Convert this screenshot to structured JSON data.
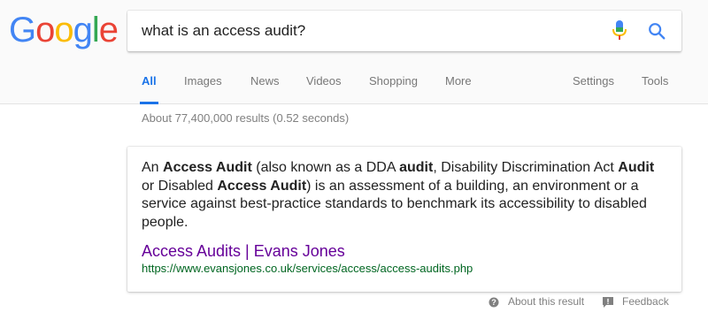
{
  "logo": {
    "letters": [
      "G",
      "o",
      "o",
      "g",
      "l",
      "e"
    ],
    "colors": [
      "#4285F4",
      "#EA4335",
      "#FBBC05",
      "#4285F4",
      "#34A853",
      "#EA4335"
    ]
  },
  "search": {
    "query": "what is an access audit?",
    "mic_icon": "microphone-icon",
    "search_icon": "search-icon"
  },
  "tabs": {
    "items": [
      {
        "label": "All",
        "active": true
      },
      {
        "label": "Images"
      },
      {
        "label": "News"
      },
      {
        "label": "Videos"
      },
      {
        "label": "Shopping"
      },
      {
        "label": "More"
      }
    ],
    "settings_label": "Settings",
    "tools_label": "Tools",
    "accent_color": "#1a73e8"
  },
  "results": {
    "stats": "About 77,400,000 results (0.52 seconds)"
  },
  "featured_snippet": {
    "segments": [
      {
        "text": "An ",
        "bold": false
      },
      {
        "text": "Access Audit",
        "bold": true
      },
      {
        "text": " (also known as a DDA ",
        "bold": false
      },
      {
        "text": "audit",
        "bold": true
      },
      {
        "text": ", Disability Discrimination Act ",
        "bold": false
      },
      {
        "text": "Audit",
        "bold": true
      },
      {
        "text": " or Disabled ",
        "bold": false
      },
      {
        "text": "Access Audit",
        "bold": true
      },
      {
        "text": ") is an assessment of a building, an environment or a service against best-practice standards to benchmark its accessibility to disabled people.",
        "bold": false
      }
    ],
    "title": "Access Audits | Evans Jones",
    "url": "https://www.evansjones.co.uk/services/access/access-audits.php",
    "title_color": "#660099",
    "url_color": "#006621"
  },
  "footer": {
    "about_label": "About this result",
    "about_icon": "info-icon",
    "feedback_label": "Feedback",
    "feedback_icon": "feedback-icon"
  }
}
